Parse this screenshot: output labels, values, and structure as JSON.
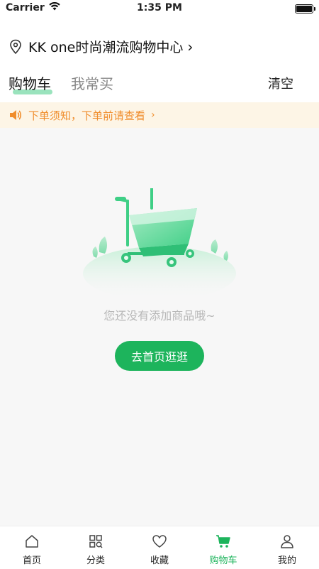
{
  "status_bar": {
    "carrier": "Carrier",
    "time": "1:35 PM"
  },
  "header": {
    "location": "KK one时尚潮流购物中心",
    "tabs": [
      {
        "label": "购物车"
      },
      {
        "label": "我常买"
      }
    ],
    "clear_label": "清空"
  },
  "notice": {
    "text": "下单须知，下单前请查看",
    "color": "#f08d2c"
  },
  "empty_state": {
    "message": "您还没有添加商品哦~",
    "button_label": "去首页逛逛"
  },
  "tabbar": {
    "items": [
      {
        "label": "首页",
        "icon": "home-icon"
      },
      {
        "label": "分类",
        "icon": "category-icon"
      },
      {
        "label": "收藏",
        "icon": "heart-icon"
      },
      {
        "label": "购物车",
        "icon": "cart-icon"
      },
      {
        "label": "我的",
        "icon": "profile-icon"
      }
    ]
  },
  "colors": {
    "accent": "#1db45c",
    "notice_bg": "#fdf5e6",
    "tab_highlight": "#8fe0b6"
  }
}
